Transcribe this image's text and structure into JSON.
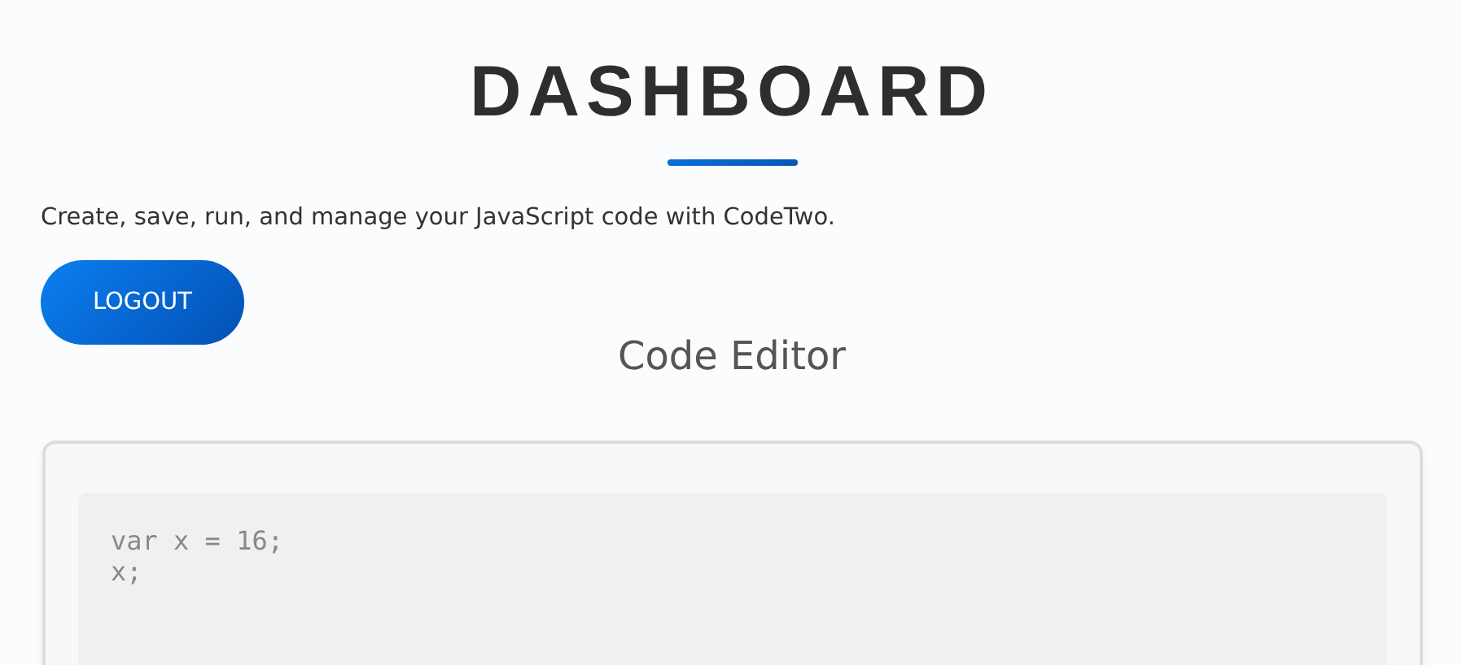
{
  "header": {
    "title": "DASHBOARD",
    "description": "Create, save, run, and manage your JavaScript code with CodeTwo."
  },
  "logout_button": {
    "label": "LOGOUT"
  },
  "editor": {
    "heading": "Code Editor",
    "code": "var x = 16;\nx;"
  }
}
